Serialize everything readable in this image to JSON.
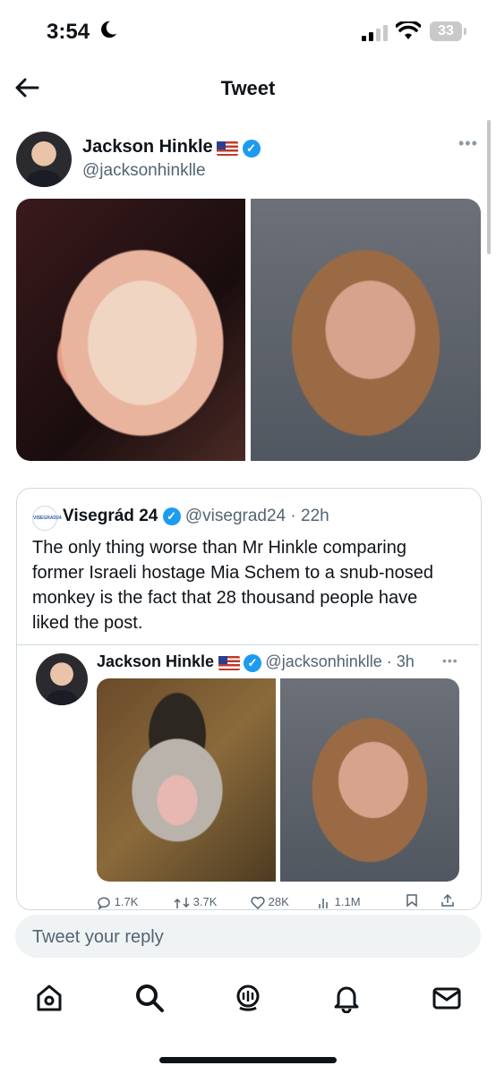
{
  "status_bar": {
    "time": "3:54",
    "battery": "33"
  },
  "header": {
    "title": "Tweet"
  },
  "tweet": {
    "author_name": "Jackson Hinkle",
    "author_handle": "@jacksonhinklle",
    "images": [
      "fish-photo",
      "woman-photo"
    ]
  },
  "quote": {
    "author_name": "Visegrád 24",
    "logo_text": "VISEGRAD24",
    "author_handle": "@visegrad24",
    "time": "22h",
    "text": "The only thing worse than Mr Hinkle comparing former Israeli hostage Mia Schem to a snub-nosed monkey is the fact that 28 thousand people have liked the post.",
    "nested": {
      "author_name": "Jackson Hinkle",
      "author_handle": "@jacksonhinklle",
      "time": "3h",
      "images": [
        "monkey-photo",
        "woman-photo"
      ]
    },
    "stats": {
      "replies": "1.7K",
      "retweets": "3.7K",
      "likes": "28K",
      "views": "1.1M"
    }
  },
  "reply": {
    "placeholder": "Tweet your reply"
  },
  "bottom_nav": [
    "home-icon",
    "search-icon",
    "spaces-icon",
    "notifications-icon",
    "messages-icon"
  ]
}
